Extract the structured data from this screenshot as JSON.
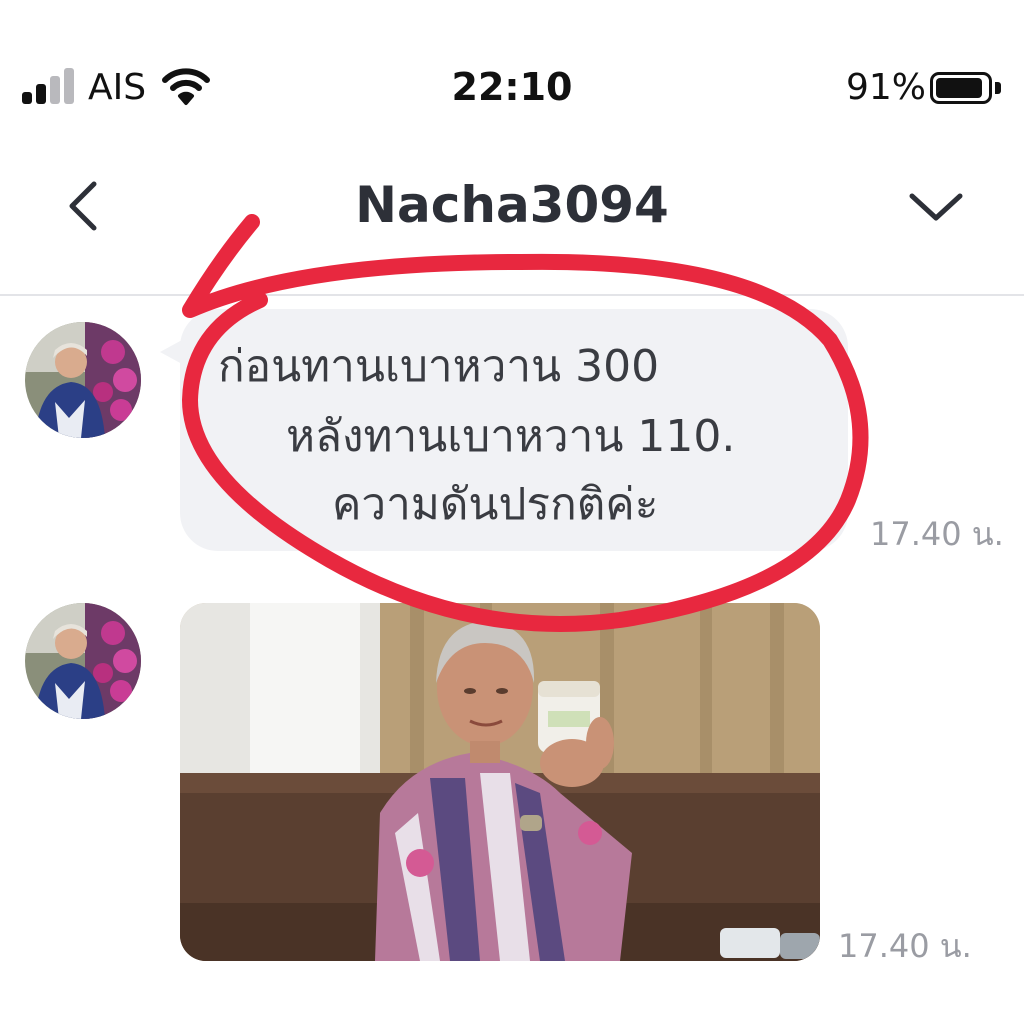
{
  "status_bar": {
    "carrier": "AIS",
    "time": "22:10",
    "battery_percent": "91%",
    "battery_level": 0.91,
    "signal_bars_active": 2,
    "signal_bars_total": 4
  },
  "nav": {
    "title": "Nacha3094",
    "back_icon": "chevron-left-icon",
    "menu_icon": "chevron-down-icon"
  },
  "messages": [
    {
      "type": "text",
      "lines": [
        "ก่อนทานเบาหวาน 300",
        "หลังทานเบาหวาน  110.",
        "ความดันปรกติค่ะ"
      ],
      "time": "17.40 น."
    },
    {
      "type": "photo",
      "time": "17.40 น."
    }
  ],
  "colors": {
    "annotation_circle": "#e8283f",
    "bubble": "#f1f2f5",
    "timestamp": "#9a9ca3"
  }
}
